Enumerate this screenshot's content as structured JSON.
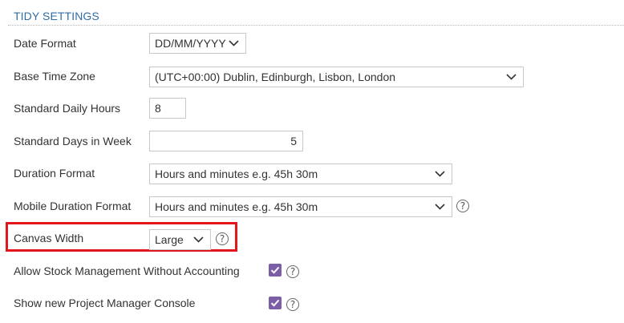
{
  "section": {
    "title": "TIDY SETTINGS"
  },
  "fields": {
    "date_format": {
      "label": "Date Format",
      "value": "DD/MM/YYYY"
    },
    "base_time_zone": {
      "label": "Base Time Zone",
      "value": "(UTC+00:00) Dublin, Edinburgh, Lisbon, London"
    },
    "standard_daily_hours": {
      "label": "Standard Daily Hours",
      "value": "8"
    },
    "standard_days_in_week": {
      "label": "Standard Days in Week",
      "value": "5"
    },
    "duration_format": {
      "label": "Duration Format",
      "value": "Hours and minutes e.g. 45h 30m"
    },
    "mobile_duration_format": {
      "label": "Mobile Duration Format",
      "value": "Hours and minutes e.g. 45h 30m"
    },
    "canvas_width": {
      "label": "Canvas Width",
      "value": "Large"
    },
    "allow_stock_management": {
      "label": "Allow Stock Management Without Accounting",
      "checked": true
    },
    "show_project_manager_console": {
      "label": "Show new Project Manager Console",
      "checked": true
    }
  },
  "help_glyph": "?",
  "icons": {
    "dropdown": "chevron-down-icon",
    "help": "help-icon",
    "check": "checkmark-icon"
  },
  "colors": {
    "accent": "#7b5ea7",
    "title": "#2e6da4",
    "highlight": "#e3161b"
  }
}
